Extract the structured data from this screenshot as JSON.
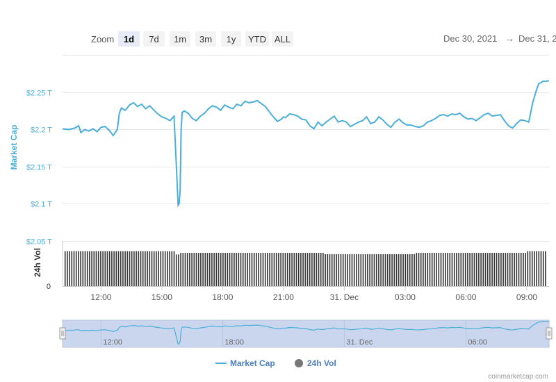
{
  "toolbar": {
    "zoom_label": "Zoom",
    "zoom_options": [
      {
        "label": "1d",
        "active": true
      },
      {
        "label": "7d",
        "active": false
      },
      {
        "label": "1m",
        "active": false
      },
      {
        "label": "3m",
        "active": false
      },
      {
        "label": "1y",
        "active": false
      },
      {
        "label": "YTD",
        "active": false
      },
      {
        "label": "ALL",
        "active": false
      }
    ]
  },
  "date_range": {
    "from": "Dec 30, 2021",
    "arrow": "→",
    "to": "Dec 31, 2"
  },
  "credit": "coinmarketcap.com",
  "colors": {
    "market_cap": "#4aaed9",
    "volume": "#333333",
    "navigator_fill": "#c9d6ee",
    "active_zoom": "#e6ebf5"
  },
  "chart_data": {
    "type": "line",
    "y_axis": {
      "label": "Market Cap",
      "ticks": [
        "$2.25 T",
        "$2.2 T",
        "$2.15 T",
        "$2.1 T",
        "$2.05 T"
      ],
      "tick_values": [
        2.25,
        2.2,
        2.15,
        2.1,
        2.05
      ],
      "range": [
        2.05,
        2.275
      ]
    },
    "volume_axis": {
      "label": "24h Vol",
      "ticks": [
        "0"
      ],
      "range": [
        0,
        1.5
      ]
    },
    "x_axis": {
      "ticks": [
        "12:00",
        "15:00",
        "18:00",
        "21:00",
        "31. Dec",
        "03:00",
        "06:00",
        "09:00"
      ],
      "tick_hours": [
        12,
        15,
        18,
        21,
        24,
        27,
        30,
        33
      ],
      "range_hours": [
        10.1,
        34.1
      ]
    },
    "navigator_ticks": [
      "12:00",
      "18:00",
      "31. Dec",
      "06:00"
    ],
    "navigator_tick_hours": [
      12,
      18,
      24,
      30
    ],
    "legend": [
      {
        "name": "Market Cap",
        "symbol": "line"
      },
      {
        "name": "24h Vol",
        "symbol": "circle"
      }
    ],
    "series": [
      {
        "name": "Market Cap",
        "x_hours": [
          10.1,
          10.4,
          10.7,
          10.9,
          11.0,
          11.2,
          11.4,
          11.6,
          11.8,
          12.0,
          12.2,
          12.4,
          12.6,
          12.8,
          12.9,
          13.0,
          13.2,
          13.4,
          13.6,
          13.8,
          14.0,
          14.2,
          14.4,
          14.6,
          14.8,
          15.0,
          15.2,
          15.4,
          15.6,
          15.7,
          15.8,
          15.85,
          15.9,
          15.95,
          16.0,
          16.1,
          16.3,
          16.5,
          16.7,
          16.9,
          17.1,
          17.3,
          17.5,
          17.7,
          17.9,
          18.1,
          18.3,
          18.5,
          18.7,
          18.9,
          19.1,
          19.3,
          19.5,
          19.7,
          19.9,
          20.1,
          20.3,
          20.5,
          20.7,
          20.9,
          21.0,
          21.1,
          21.3,
          21.5,
          21.7,
          21.9,
          22.1,
          22.3,
          22.5,
          22.7,
          22.9,
          23.1,
          23.3,
          23.5,
          23.7,
          23.9,
          24.1,
          24.3,
          24.5,
          24.7,
          24.9,
          25.1,
          25.3,
          25.5,
          25.7,
          25.9,
          26.1,
          26.3,
          26.5,
          26.7,
          26.9,
          27.1,
          27.3,
          27.5,
          27.7,
          27.9,
          28.1,
          28.3,
          28.5,
          28.7,
          28.9,
          29.1,
          29.3,
          29.5,
          29.7,
          29.9,
          30.1,
          30.3,
          30.5,
          30.7,
          30.9,
          31.1,
          31.3,
          31.5,
          31.7,
          31.9,
          32.1,
          32.3,
          32.5,
          32.7,
          32.9,
          33.1,
          33.3,
          33.5,
          33.6,
          33.7,
          33.8,
          33.9,
          34.0,
          34.1
        ],
        "values": [
          2.201,
          2.2,
          2.202,
          2.205,
          2.196,
          2.2,
          2.198,
          2.201,
          2.197,
          2.203,
          2.204,
          2.199,
          2.192,
          2.2,
          2.222,
          2.229,
          2.226,
          2.233,
          2.236,
          2.231,
          2.234,
          2.228,
          2.232,
          2.226,
          2.221,
          2.217,
          2.215,
          2.212,
          2.218,
          2.16,
          2.098,
          2.1,
          2.118,
          2.2,
          2.223,
          2.225,
          2.222,
          2.215,
          2.212,
          2.218,
          2.222,
          2.228,
          2.232,
          2.23,
          2.226,
          2.233,
          2.23,
          2.228,
          2.234,
          2.232,
          2.238,
          2.236,
          2.237,
          2.239,
          2.235,
          2.231,
          2.224,
          2.217,
          2.211,
          2.214,
          2.217,
          2.216,
          2.221,
          2.22,
          2.218,
          2.214,
          2.213,
          2.205,
          2.201,
          2.21,
          2.205,
          2.21,
          2.214,
          2.218,
          2.21,
          2.212,
          2.21,
          2.204,
          2.207,
          2.21,
          2.212,
          2.217,
          2.208,
          2.21,
          2.217,
          2.213,
          2.207,
          2.203,
          2.21,
          2.214,
          2.209,
          2.206,
          2.206,
          2.204,
          2.203,
          2.205,
          2.21,
          2.212,
          2.215,
          2.219,
          2.22,
          2.218,
          2.221,
          2.22,
          2.222,
          2.217,
          2.214,
          2.215,
          2.212,
          2.216,
          2.22,
          2.222,
          2.218,
          2.219,
          2.22,
          2.212,
          2.205,
          2.202,
          2.208,
          2.213,
          2.212,
          2.21,
          2.237,
          2.255,
          2.262,
          2.263,
          2.265,
          2.265,
          2.265,
          2.266
        ]
      },
      {
        "name": "24h Vol",
        "x_range_hours": [
          10.2,
          34.0
        ],
        "segments": [
          {
            "from_hours": 10.2,
            "to_hours": 15.6,
            "value": 1.05
          },
          {
            "from_hours": 15.6,
            "to_hours": 15.9,
            "value": 0.95
          },
          {
            "from_hours": 15.9,
            "to_hours": 23.0,
            "value": 1.0
          },
          {
            "from_hours": 23.0,
            "to_hours": 27.5,
            "value": 0.96
          },
          {
            "from_hours": 27.5,
            "to_hours": 33.0,
            "value": 1.0
          },
          {
            "from_hours": 33.0,
            "to_hours": 34.0,
            "value": 1.05
          }
        ]
      }
    ]
  }
}
